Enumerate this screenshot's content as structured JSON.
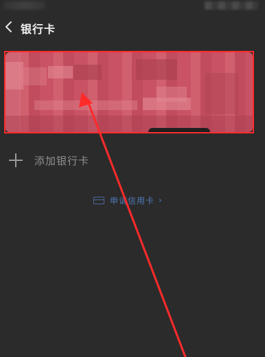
{
  "nav": {
    "title": "银行卡",
    "back_icon": "chevron-left-icon"
  },
  "card": {
    "content_state": "pixelated",
    "accent_color": "#c95364",
    "highlight_color": "#ff2b2b"
  },
  "add_card": {
    "label": "添加银行卡",
    "icon": "plus-icon"
  },
  "apply_credit": {
    "label": "申请信用卡",
    "icon": "credit-card-icon",
    "chevron": "›",
    "color": "#4f7ab6"
  },
  "annotation": {
    "arrow_color": "#ff2b2b"
  }
}
